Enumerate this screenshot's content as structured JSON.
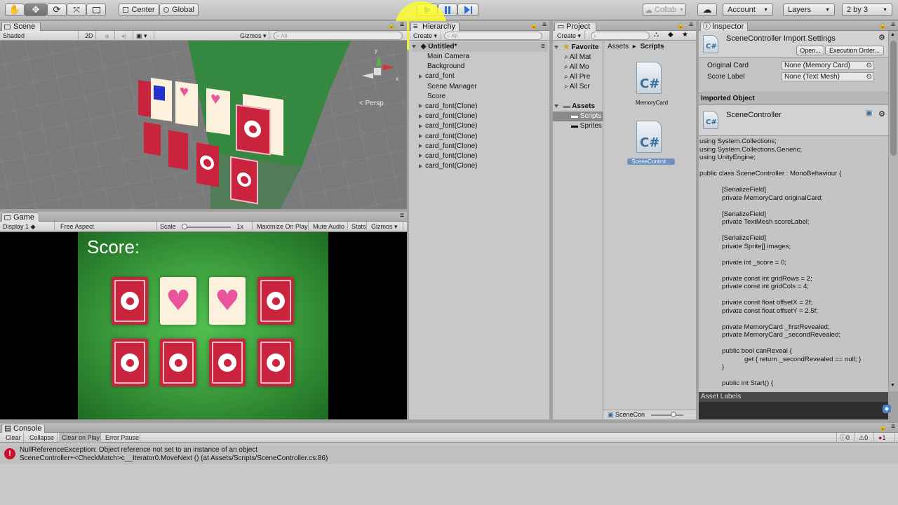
{
  "toolbar": {
    "tools": [
      "hand-tool",
      "move-tool",
      "rotate-tool",
      "scale-tool",
      "rect-tool"
    ],
    "pivot": "Center",
    "space": "Global",
    "collab": "Collab",
    "account": "Account",
    "layers": "Layers",
    "layout": "2 by 3"
  },
  "scene": {
    "tab": "Scene",
    "shading": "Shaded",
    "mode2d": "2D",
    "gizmos": "Gizmos",
    "search_placeholder": "All",
    "persp": "< Persp"
  },
  "game": {
    "tab": "Game",
    "display": "Display 1",
    "aspect": "Free Aspect",
    "scale_label": "Scale",
    "scale_value": "1x",
    "maximize": "Maximize On Play",
    "mute": "Mute Audio",
    "stats": "Stats",
    "gizmos": "Gizmos",
    "score": "Score:",
    "cards": [
      "back",
      "heart",
      "heart",
      "back",
      "back",
      "back",
      "back",
      "back"
    ]
  },
  "hierarchy": {
    "tab": "Hierarchy",
    "create": "Create",
    "search_placeholder": "All",
    "scene_name": "Untitled*",
    "items": [
      {
        "label": "Main Camera",
        "expand": false
      },
      {
        "label": "Background",
        "expand": false
      },
      {
        "label": "card_font",
        "expand": true
      },
      {
        "label": "Scene Manager",
        "expand": false
      },
      {
        "label": "Score",
        "expand": false
      },
      {
        "label": "card_font(Clone)",
        "expand": true
      },
      {
        "label": "card_font(Clone)",
        "expand": true
      },
      {
        "label": "card_font(Clone)",
        "expand": true
      },
      {
        "label": "card_font(Clone)",
        "expand": true
      },
      {
        "label": "card_font(Clone)",
        "expand": true
      },
      {
        "label": "card_font(Clone)",
        "expand": true
      },
      {
        "label": "card_font(Clone)",
        "expand": true
      }
    ]
  },
  "project": {
    "tab": "Project",
    "create": "Create",
    "favorites": "Favorite",
    "fav_items": [
      "All Mat",
      "All Mo",
      "All Pre",
      "All Scr"
    ],
    "assets": "Assets",
    "asset_items": [
      "Scripts",
      "Sprites"
    ],
    "breadcrumb": [
      "Assets",
      "Scripts"
    ],
    "files": [
      "MemoryCard",
      "SceneControl..."
    ],
    "footer_file": "SceneCon"
  },
  "inspector": {
    "tab": "Inspector",
    "title": "SceneController Import Settings",
    "open": "Open...",
    "exec_order": "Execution Order...",
    "fields": [
      {
        "label": "Original Card",
        "value": "None (Memory Card)"
      },
      {
        "label": "Score Label",
        "value": "None (Text Mesh)"
      }
    ],
    "imported_header": "Imported Object",
    "imported_name": "SceneController",
    "code_lines": [
      "using System.Collections;",
      "using System.Collections.Generic;",
      "using UnityEngine;",
      "",
      "public class SceneController : MonoBehaviour {",
      "",
      "            [SerializeField]",
      "            private MemoryCard originalCard;",
      "",
      "            [SerializeField]",
      "            private TextMesh scoreLabel;",
      "",
      "            [SerializeField]",
      "            private Sprite[] images;",
      "",
      "            private int _score = 0;",
      "",
      "            private const int gridRows = 2;",
      "            private const int gridCols = 4;",
      "",
      "            private const float offsetX = 2f;",
      "            private const float offsetY = 2.5f;",
      "",
      "            private MemoryCard _firstRevealed;",
      "            private MemoryCard _secondRevealed;",
      "",
      "            public bool canReveal {",
      "                        get { return _secondRevealed == null; }",
      "            }",
      "",
      "            public int Start() {"
    ],
    "asset_labels": "Asset Labels"
  },
  "console": {
    "tab": "Console",
    "buttons": [
      "Clear",
      "Collapse",
      "Clear on Play",
      "Error Pause"
    ],
    "counts": [
      "0",
      "0",
      "1"
    ],
    "error_line1": "NullReferenceException: Object reference not set to an instance of an object",
    "error_line2": "SceneController+<CheckMatch>c__Iterator0.MoveNext () (at Assets/Scripts/SceneController.cs:86)"
  },
  "colors": {
    "error": "#c8102e",
    "card_back": "#c9233e",
    "heart": "#e8559c",
    "game_green": "#3ea03e",
    "play_blue": "#2a6fd6"
  }
}
